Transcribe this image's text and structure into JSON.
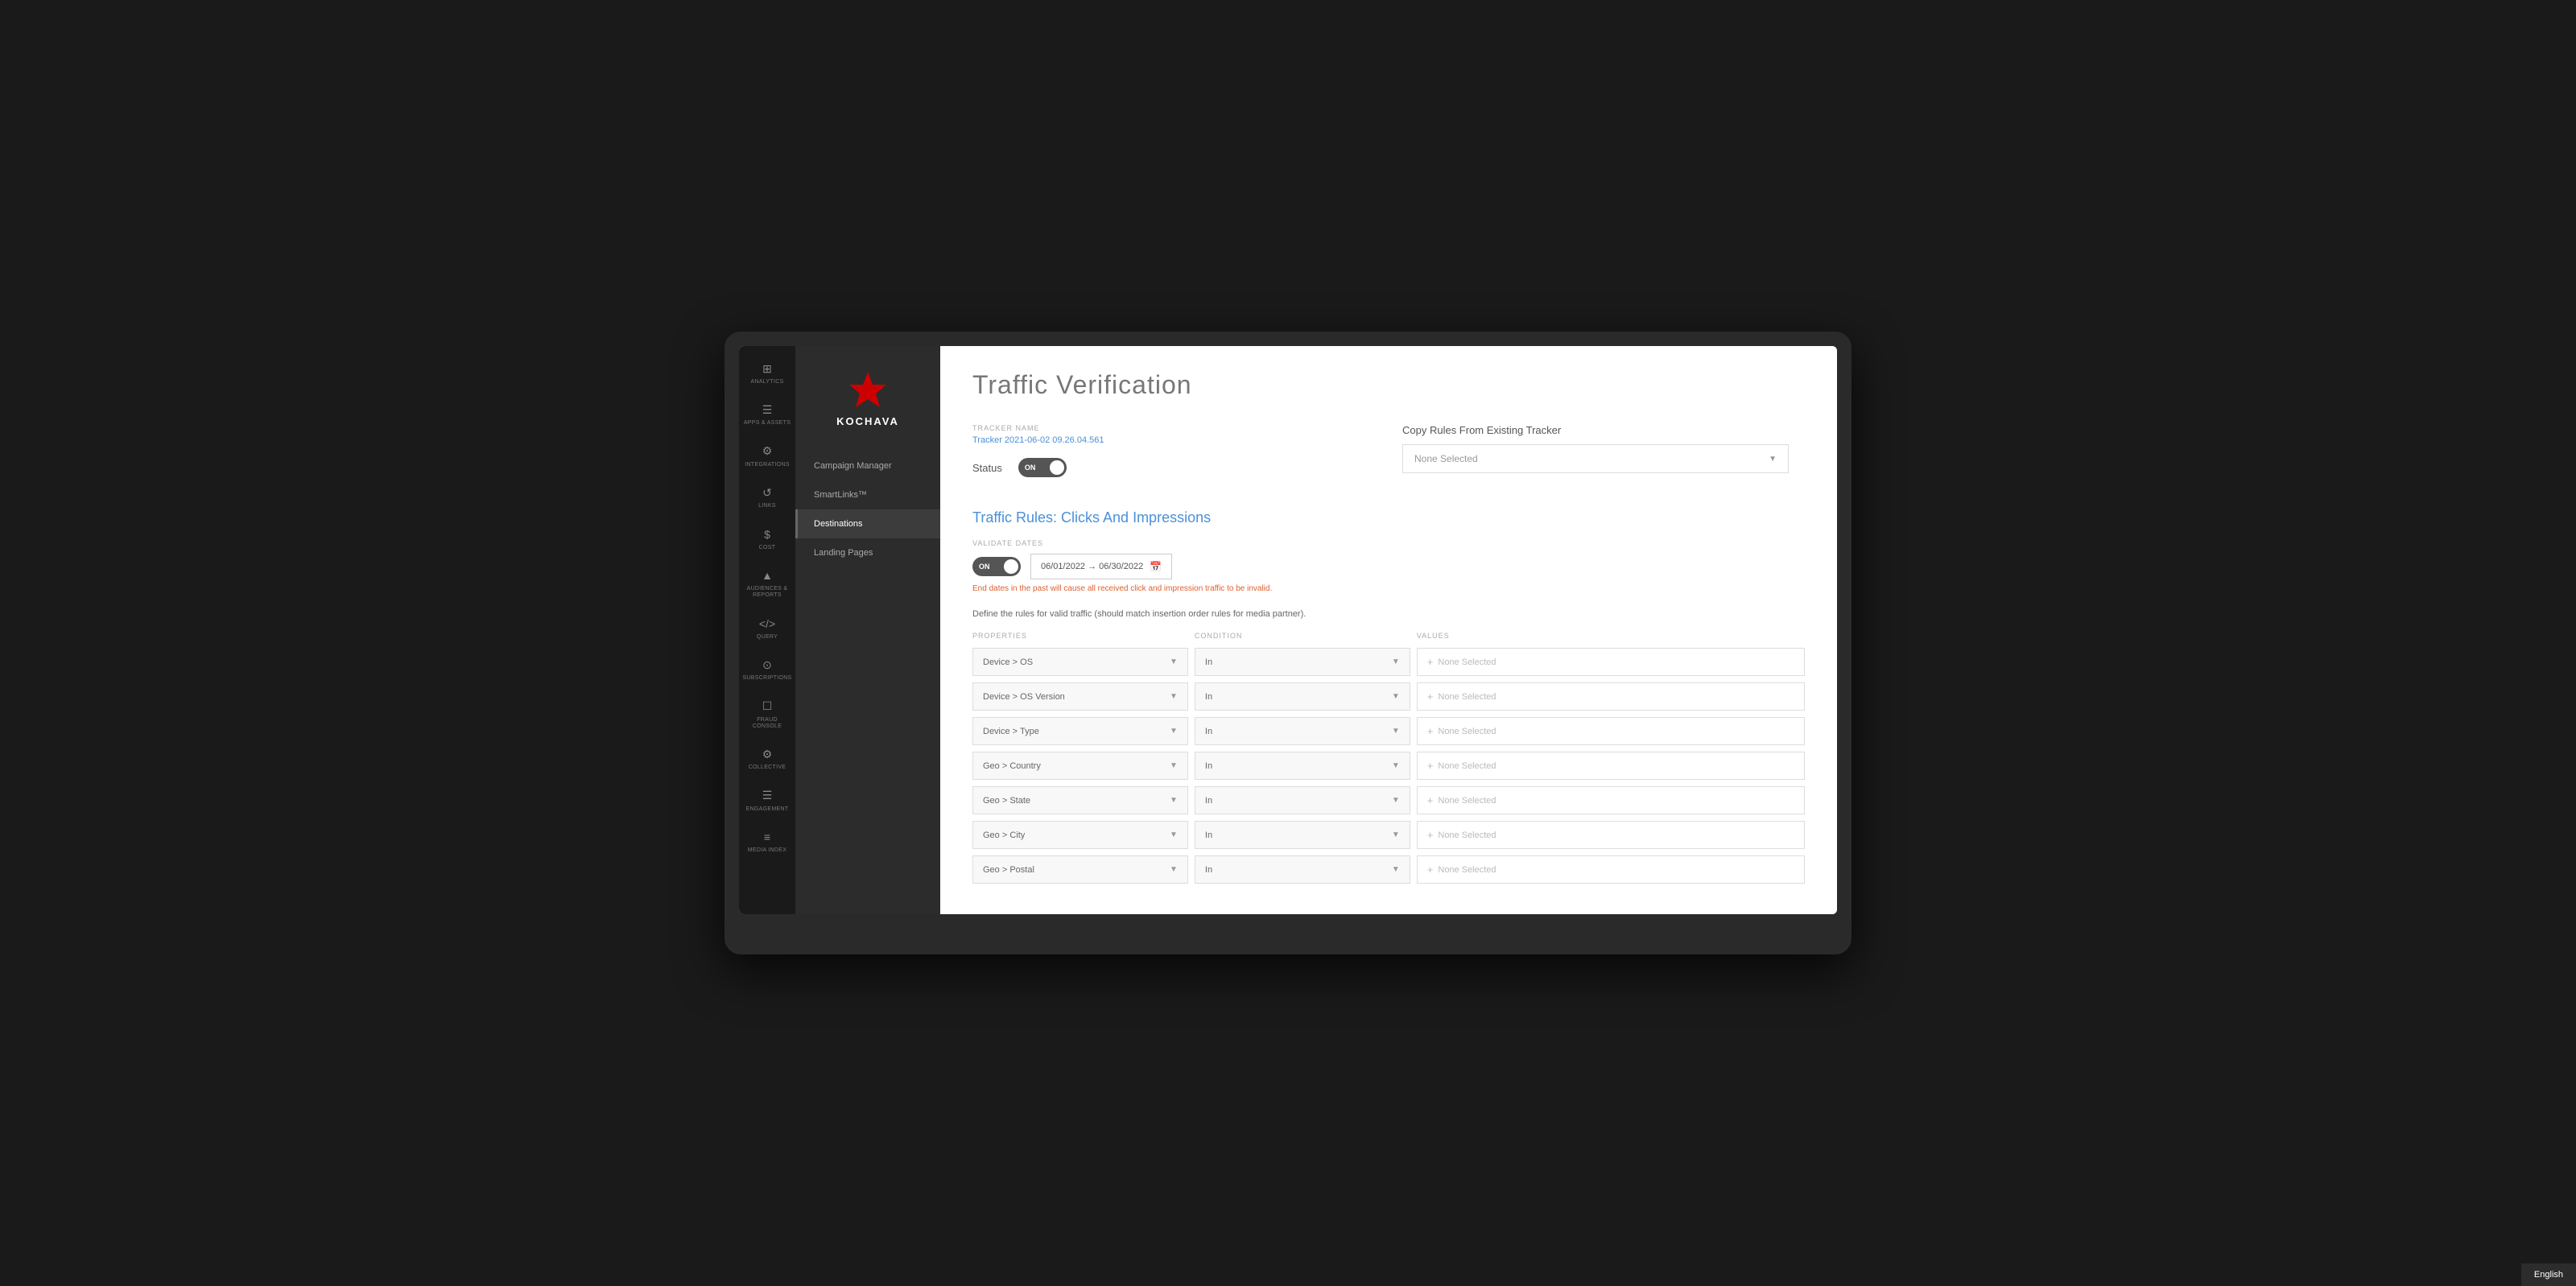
{
  "app": {
    "title": "Traffic Verification"
  },
  "icon_sidebar": {
    "items": [
      {
        "id": "analytics",
        "icon": "⊞",
        "label": "Analytics"
      },
      {
        "id": "apps-assets",
        "icon": "≡",
        "label": "Apps & Assets"
      },
      {
        "id": "integrations",
        "icon": "⚙",
        "label": "Integrations"
      },
      {
        "id": "links",
        "icon": "↺",
        "label": "Links"
      },
      {
        "id": "cost",
        "icon": "$",
        "label": "Cost"
      },
      {
        "id": "audiences",
        "icon": "⬆",
        "label": "Audiences & Reports"
      },
      {
        "id": "query",
        "icon": "<>",
        "label": "Query"
      },
      {
        "id": "subscriptions",
        "icon": "©",
        "label": "Subscriptions"
      },
      {
        "id": "fraud-console",
        "icon": "☐",
        "label": "Fraud Console"
      },
      {
        "id": "collective",
        "icon": "⚙",
        "label": "Collective"
      },
      {
        "id": "engagement",
        "icon": "☰",
        "label": "Engagement"
      },
      {
        "id": "media-index",
        "icon": "≡",
        "label": "Media Index"
      }
    ]
  },
  "nav_sidebar": {
    "logo_text": "KOCHAVA",
    "items": [
      {
        "id": "campaign-manager",
        "label": "Campaign Manager",
        "active": false
      },
      {
        "id": "smartlinks",
        "label": "SmartLinks™",
        "active": false
      },
      {
        "id": "destinations",
        "label": "Destinations",
        "active": true
      },
      {
        "id": "landing-pages",
        "label": "Landing Pages",
        "active": false
      }
    ]
  },
  "tracker": {
    "name_label": "Tracker Name",
    "name_value": "Tracker 2021-06-02 09.26.04.561",
    "name_link_text": "Tracker"
  },
  "status": {
    "label": "Status",
    "toggle_state": "ON"
  },
  "copy_rules": {
    "title": "Copy Rules From Existing Tracker",
    "placeholder": "None Selected"
  },
  "traffic_rules": {
    "title": "Traffic Rules: Clicks And Impressions"
  },
  "validate_dates": {
    "label": "Validate Dates",
    "toggle_state": "ON",
    "date_range": "06/01/2022 → 06/30/2022",
    "warning": "End dates in the past will cause all received click and impression traffic to be invalid."
  },
  "define_rules_text": "Define the rules for valid traffic (should match insertion order rules for media partner).",
  "rules_headers": {
    "properties": "Properties",
    "condition": "Condition",
    "values": "Values"
  },
  "rules_rows": [
    {
      "property": "Device > OS",
      "condition": "In",
      "value": "None Selected"
    },
    {
      "property": "Device > OS Version",
      "condition": "In",
      "value": "None Selected"
    },
    {
      "property": "Device > Type",
      "condition": "In",
      "value": "None Selected"
    },
    {
      "property": "Geo > Country",
      "condition": "In",
      "value": "None Selected"
    },
    {
      "property": "Geo > State",
      "condition": "In",
      "value": "None Selected"
    },
    {
      "property": "Geo > City",
      "condition": "In",
      "value": "None Selected"
    },
    {
      "property": "Geo > Postal",
      "condition": "In",
      "value": "None Selected"
    }
  ],
  "footer": {
    "language": "English"
  }
}
